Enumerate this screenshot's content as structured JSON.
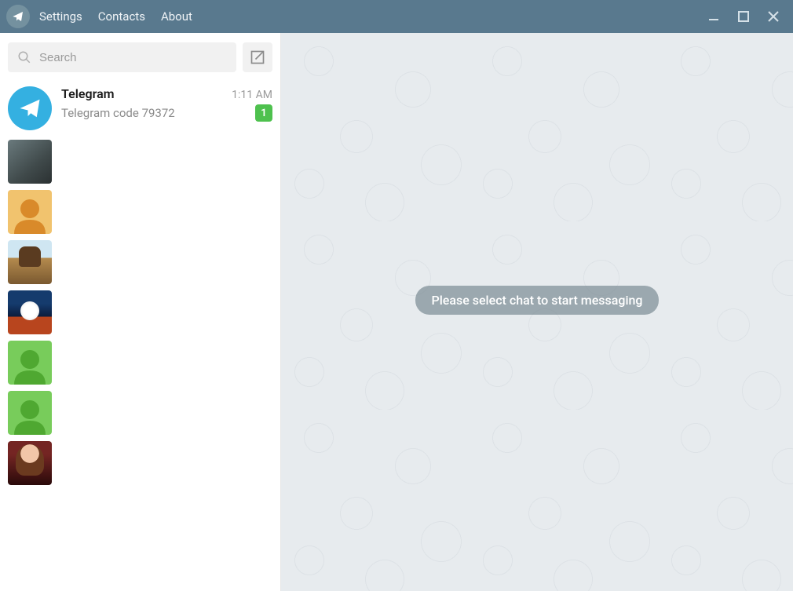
{
  "titlebar": {
    "menu": {
      "settings": "Settings",
      "contacts": "Contacts",
      "about": "About"
    }
  },
  "search": {
    "placeholder": "Search"
  },
  "empty_state": {
    "message": "Please select chat to start messaging"
  },
  "chats": [
    {
      "name": "Telegram",
      "time": "1:11 AM",
      "preview": "Telegram code 79372",
      "badge": "1",
      "avatar": "telegram"
    }
  ]
}
